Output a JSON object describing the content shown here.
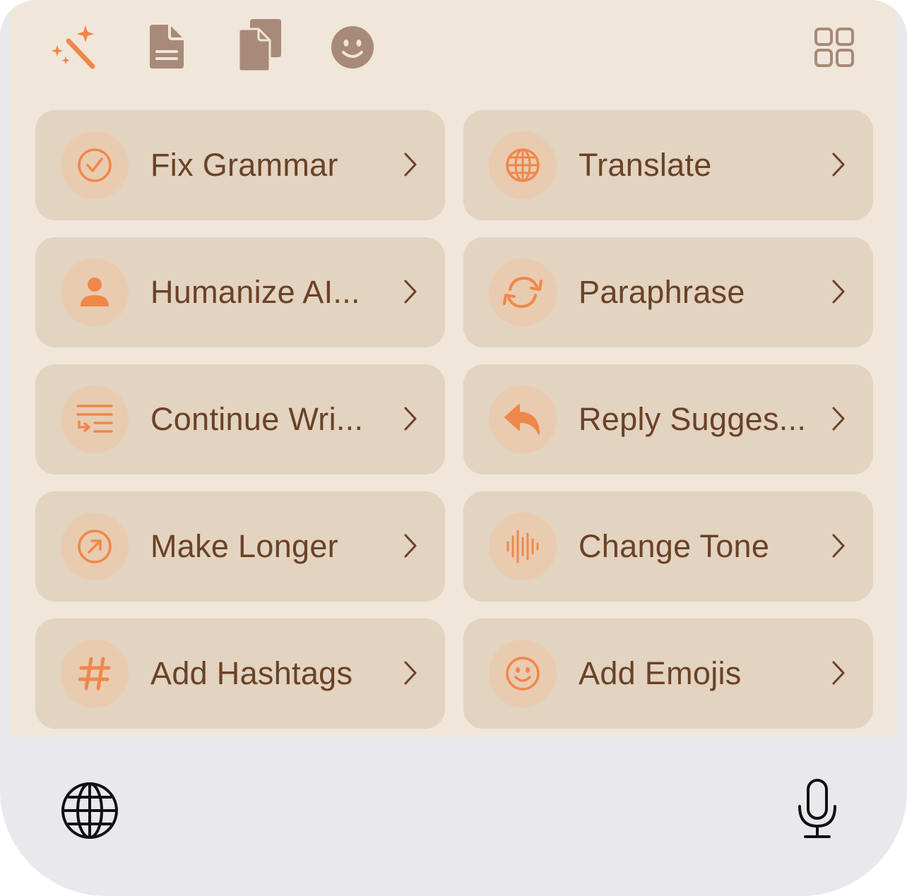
{
  "toolbar": {
    "icons": [
      "magic-wand-icon",
      "document-icon",
      "copy-documents-icon",
      "smiley-face-icon"
    ],
    "right_icon": "grid-icon"
  },
  "actions": [
    {
      "label": "Fix Grammar",
      "icon": "checkmark-circle-icon"
    },
    {
      "label": "Translate",
      "icon": "globe-icon"
    },
    {
      "label": "Humanize AI...",
      "icon": "person-icon"
    },
    {
      "label": "Paraphrase",
      "icon": "refresh-arrows-icon"
    },
    {
      "label": "Continue Wri...",
      "icon": "text-continue-icon"
    },
    {
      "label": "Reply Sugges...",
      "icon": "reply-arrow-icon"
    },
    {
      "label": "Make Longer",
      "icon": "arrow-up-right-circle-icon"
    },
    {
      "label": "Change Tone",
      "icon": "waveform-icon"
    },
    {
      "label": "Add Hashtags",
      "icon": "hashtag-icon"
    },
    {
      "label": "Add Emojis",
      "icon": "emoji-icon"
    }
  ],
  "keyboard_bar": {
    "left_icon": "globe-icon",
    "right_icon": "microphone-icon"
  },
  "colors": {
    "panel_bg": "#f0e6da",
    "card_bg": "#e3d3c1",
    "icon_circle_bg": "#e9cbb0",
    "accent_orange": "#f0874a",
    "label_brown": "#6a4226",
    "toolbar_icon": "#a88a78",
    "keyboard_bg": "#e8e8ed"
  }
}
